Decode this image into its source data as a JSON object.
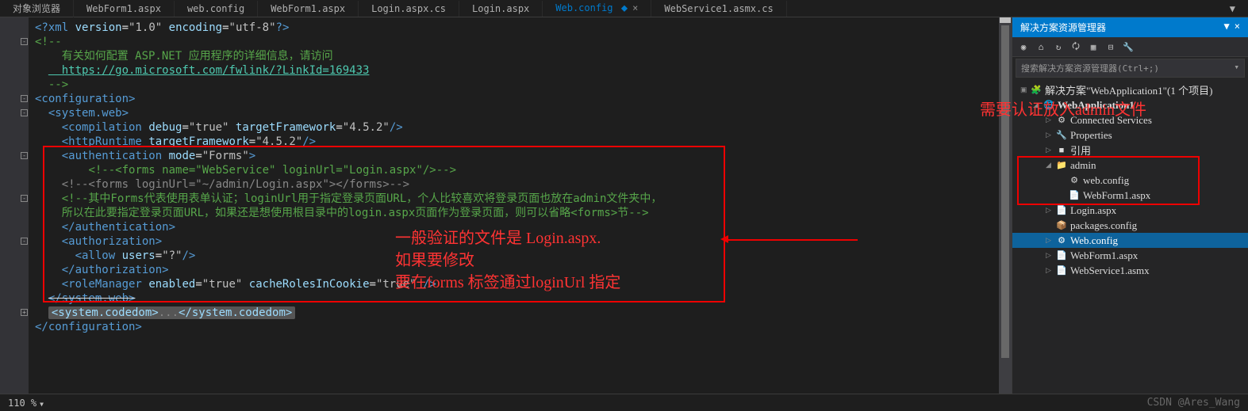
{
  "tabs": [
    {
      "label": "对象浏览器"
    },
    {
      "label": "WebForm1.aspx"
    },
    {
      "label": "web.config"
    },
    {
      "label": "WebForm1.aspx"
    },
    {
      "label": "Login.aspx.cs"
    },
    {
      "label": "Login.aspx"
    },
    {
      "label": "Web.config",
      "active": true,
      "close": "×"
    },
    {
      "label": "WebService1.asmx.cs"
    }
  ],
  "code_lines": {
    "l1": "<?xml version=\"1.0\" encoding=\"utf-8\"?>",
    "l2": "<!--",
    "l3": "  有关如何配置 ASP.NET 应用程序的详细信息，请访问",
    "l4": "  https://go.microsoft.com/fwlink/?LinkId=169433",
    "l5": "  -->",
    "l6": "<configuration>",
    "l7": "  <system.web>",
    "l8": "    <compilation debug=\"true\" targetFramework=\"4.5.2\"/>",
    "l9": "    <httpRuntime targetFramework=\"4.5.2\"/>",
    "l10": "    <authentication mode=\"Forms\">",
    "l11": "        <!--<forms name=\"WebService\" loginUrl=\"Login.aspx\"/>-->",
    "l12": "    <!--<forms loginUrl=\"~/admin/Login.aspx\"></forms>-->",
    "l13": "    <!--其中Forms代表使用表单认证；loginUrl用于指定登录页面URL，个人比较喜欢将登录页面也放在admin文件夹中，",
    "l14": "    所以在此要指定登录页面URL，如果还是想使用根目录中的login.aspx页面作为登录页面，则可以省略<forms>节-->",
    "l15": "    </authentication>",
    "l16": "    <authorization>",
    "l17": "      <allow users=\"?\"/>",
    "l18": "    </authorization>",
    "l19": "    <roleManager enabled=\"true\" cacheRolesInCookie=\"true\" />",
    "l20": "  </system.web>",
    "l21": "  <system.codedom>...</system.codedom>",
    "l22": "</configuration>"
  },
  "annotations": {
    "top_red": "需要认证放入admin文件",
    "mid1": "一般验证的文件是 Login.aspx.",
    "mid2": "如果要修改",
    "mid3": "要在forms 标签通过loginUrl 指定"
  },
  "solution_panel": {
    "title": "解决方案资源管理器",
    "search_placeholder": "搜索解决方案资源管理器(Ctrl+;)",
    "tree": [
      {
        "indent": 0,
        "exp": "▣",
        "ico": "🧩",
        "label": "解决方案\"WebApplication1\"(1 个项目)"
      },
      {
        "indent": 1,
        "exp": "◢",
        "ico": "🌐",
        "label": "WebApplication1",
        "bold": true
      },
      {
        "indent": 2,
        "exp": "▷",
        "ico": "⚙",
        "label": "Connected Services"
      },
      {
        "indent": 2,
        "exp": "▷",
        "ico": "🔧",
        "label": "Properties"
      },
      {
        "indent": 2,
        "exp": "▷",
        "ico": "■",
        "label": "引用"
      },
      {
        "indent": 2,
        "exp": "◢",
        "ico": "📁",
        "label": "admin"
      },
      {
        "indent": 3,
        "exp": "",
        "ico": "⚙",
        "label": "web.config"
      },
      {
        "indent": 3,
        "exp": "",
        "ico": "📄",
        "label": "WebForm1.aspx"
      },
      {
        "indent": 2,
        "exp": "▷",
        "ico": "📄",
        "label": "Login.aspx"
      },
      {
        "indent": 2,
        "exp": "",
        "ico": "📦",
        "label": "packages.config"
      },
      {
        "indent": 2,
        "exp": "▷",
        "ico": "⚙",
        "label": "Web.config",
        "selected": true
      },
      {
        "indent": 2,
        "exp": "▷",
        "ico": "📄",
        "label": "WebForm1.aspx"
      },
      {
        "indent": 2,
        "exp": "▷",
        "ico": "📄",
        "label": "WebService1.asmx"
      }
    ]
  },
  "bottom": {
    "zoom": "110 %",
    "watermark": "CSDN @Ares_Wang"
  }
}
